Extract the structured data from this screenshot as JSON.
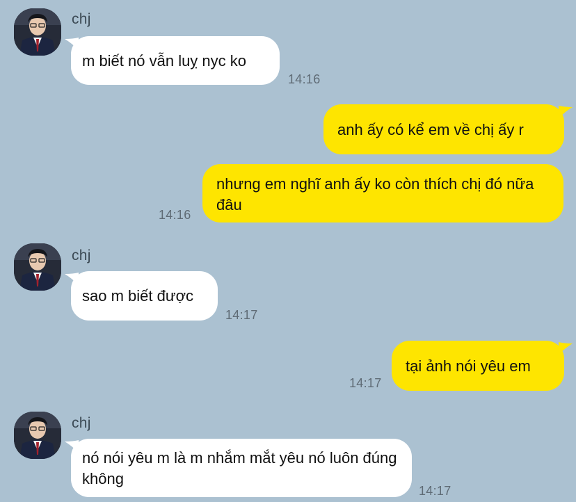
{
  "messages": [
    {
      "sender": "chj",
      "text": "m biết nó vẫn luỵ nyc ko",
      "time": "14:16"
    },
    {
      "text": "anh ấy có kể em về chị ấy r"
    },
    {
      "text": "nhưng em nghĩ anh ấy ko còn thích chị đó nữa đâu",
      "time": "14:16"
    },
    {
      "sender": "chj",
      "text": "sao m biết được",
      "time": "14:17"
    },
    {
      "text": "tại ảnh nói yêu em",
      "time": "14:17"
    },
    {
      "sender": "chj",
      "text": "nó nói yêu m là m nhắm mắt yêu nó luôn đúng không",
      "time": "14:17"
    }
  ],
  "colors": {
    "background": "#abc1d1",
    "incoming_bubble": "#ffffff",
    "outgoing_bubble": "#fee500",
    "timestamp": "#5f6b75"
  },
  "icons": {
    "avatar": "profile-photo-avatar"
  }
}
